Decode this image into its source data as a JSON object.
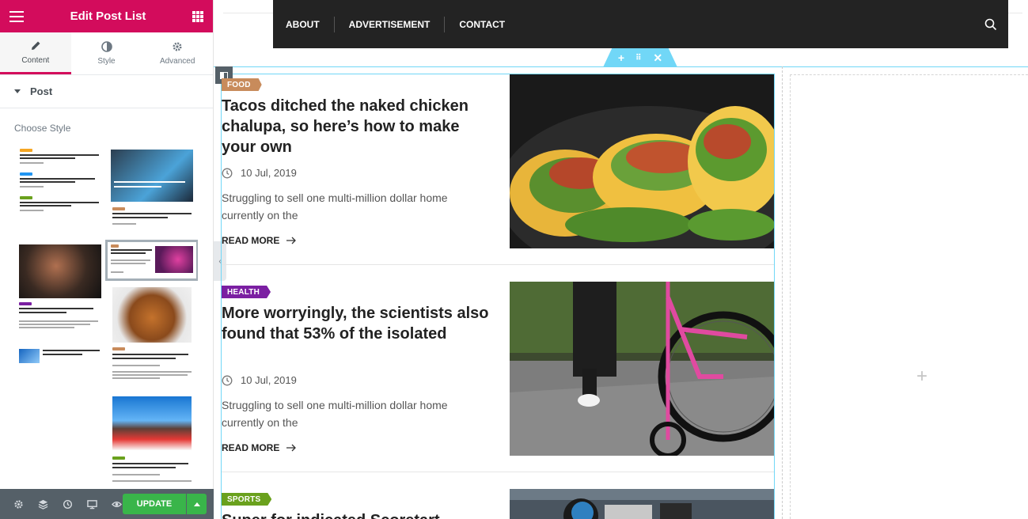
{
  "panel": {
    "title": "Edit Post List",
    "tabs": [
      {
        "label": "Content",
        "icon": "pencil-icon"
      },
      {
        "label": "Style",
        "icon": "contrast-icon"
      },
      {
        "label": "Advanced",
        "icon": "gear-icon"
      }
    ],
    "section_title": "Post",
    "choose_style_label": "Choose Style",
    "footer": {
      "update_label": "UPDATE",
      "icons": [
        "settings-icon",
        "layers-icon",
        "history-icon",
        "responsive-icon",
        "preview-icon"
      ]
    }
  },
  "nav": {
    "items": [
      "ABOUT",
      "ADVERTISEMENT",
      "CONTACT"
    ]
  },
  "colors": {
    "brand": "#d30c5c",
    "food": "#c88b5b",
    "health": "#7b1fa2",
    "sports": "#6aa11d",
    "update": "#39b54a",
    "editor_outline": "#71d7f7"
  },
  "posts": [
    {
      "category": "FOOD",
      "title": "Tacos ditched the naked chicken chalupa, so here’s how to make your own",
      "date": "10 Jul, 2019",
      "excerpt": "Struggling to sell one multi-million dollar home currently on the",
      "read_more": "READ MORE"
    },
    {
      "category": "HEALTH",
      "title": "More worryingly, the scientists also found that 53% of the isolated",
      "date": "10 Jul, 2019",
      "excerpt": "Struggling to sell one multi-million dollar home currently on the",
      "read_more": "READ MORE"
    },
    {
      "category": "SPORTS",
      "title": "Super for indicated Scoretart",
      "date": "",
      "excerpt": "",
      "read_more": ""
    }
  ]
}
